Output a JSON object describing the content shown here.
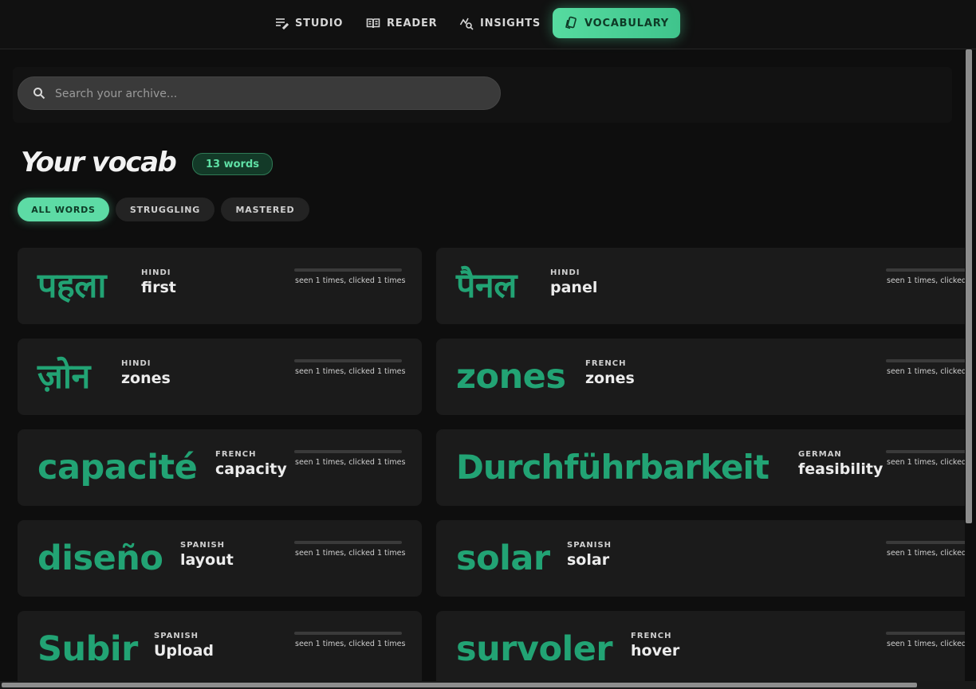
{
  "nav": {
    "tabs": [
      {
        "label": "STUDIO",
        "icon": "studio-edit-icon",
        "active": false
      },
      {
        "label": "READER",
        "icon": "book-open-icon",
        "active": false
      },
      {
        "label": "INSIGHTS",
        "icon": "insights-chart-icon",
        "active": false
      },
      {
        "label": "VOCABULARY",
        "icon": "cards-icon",
        "active": true
      }
    ]
  },
  "search": {
    "placeholder": "Search your archive...",
    "value": ""
  },
  "header": {
    "title": "Your vocab",
    "count": "13 words"
  },
  "filters": [
    {
      "label": "ALL WORDS",
      "active": true
    },
    {
      "label": "STRUGGLING",
      "active": false
    },
    {
      "label": "MASTERED",
      "active": false
    }
  ],
  "cards": [
    {
      "word": "पहला",
      "language": "HINDI",
      "meaning": "first",
      "stats": "seen 1 times, clicked 1 times",
      "progress": 0
    },
    {
      "word": "पैनल",
      "language": "HINDI",
      "meaning": "panel",
      "stats": "seen 1 times, clicked",
      "progress": 0
    },
    {
      "word": "ज़ोन",
      "language": "HINDI",
      "meaning": "zones",
      "stats": "seen 1 times, clicked 1 times",
      "progress": 0
    },
    {
      "word": "zones",
      "language": "FRENCH",
      "meaning": "zones",
      "stats": "seen 1 times, clicked",
      "progress": 0
    },
    {
      "word": "capacité",
      "language": "FRENCH",
      "meaning": "capacity",
      "stats": "seen 1 times, clicked 1 times",
      "progress": 0
    },
    {
      "word": "Durchführbarkeit",
      "language": "GERMAN",
      "meaning": "feasibility",
      "stats": "seen 1 times, clicked",
      "progress": 0
    },
    {
      "word": "diseño",
      "language": "SPANISH",
      "meaning": "layout",
      "stats": "seen 1 times, clicked 1 times",
      "progress": 0
    },
    {
      "word": "solar",
      "language": "SPANISH",
      "meaning": "solar",
      "stats": "seen 1 times, clicked",
      "progress": 0
    },
    {
      "word": "Subir",
      "language": "SPANISH",
      "meaning": "Upload",
      "stats": "seen 1 times, clicked 1 times",
      "progress": 0
    },
    {
      "word": "survoler",
      "language": "FRENCH",
      "meaning": "hover",
      "stats": "seen 1 times, clicked",
      "progress": 0
    }
  ],
  "colors": {
    "accent": "#5ddba5",
    "word": "#22a374",
    "card": "#1b1b1b"
  }
}
